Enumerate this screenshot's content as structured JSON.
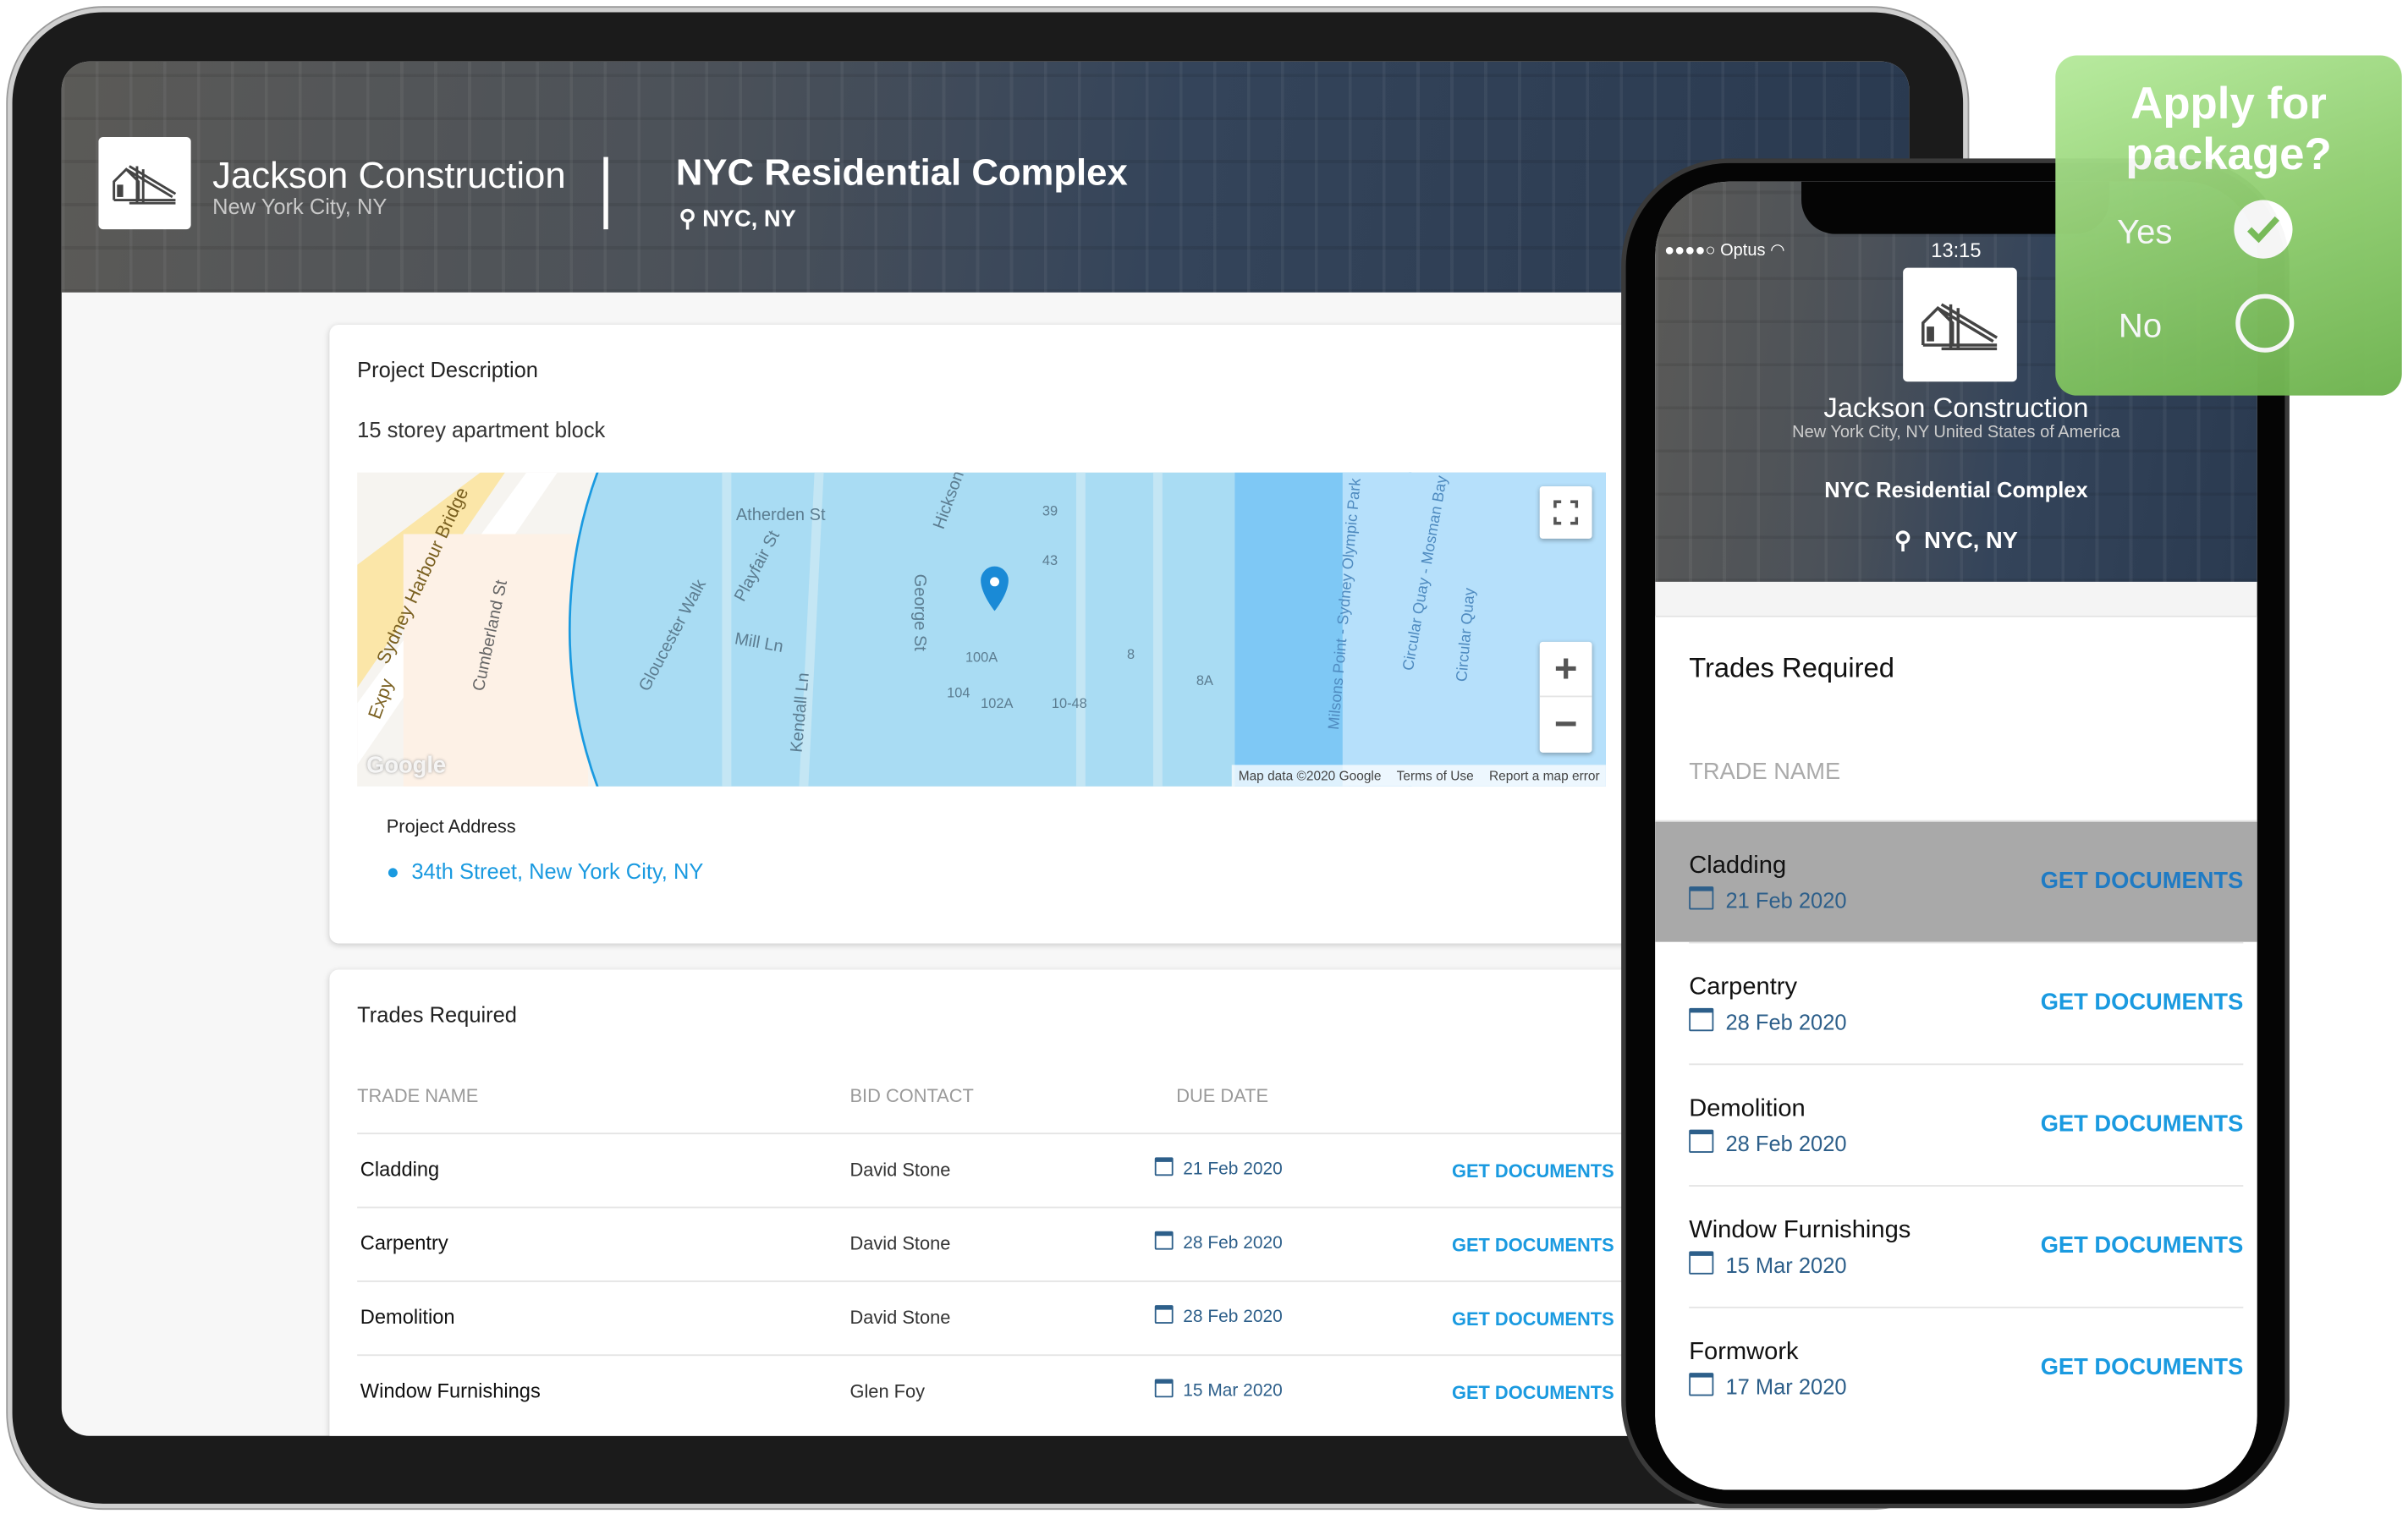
{
  "tablet": {
    "company": {
      "name": "Jackson Construction",
      "location": "New York City, NY"
    },
    "project": {
      "title": "NYC Residential Complex",
      "location": "NYC, NY"
    },
    "description": {
      "heading": "Project Description",
      "text": "15 storey apartment block"
    },
    "map": {
      "labels": [
        "Atherden St",
        "Gloucester Walk",
        "Playfair St",
        "George St",
        "Hickson",
        "Mill Ln",
        "Kendall Ln",
        "Cumberland St",
        "Sydney Harbour Bridge",
        "Expy",
        "Milsons Point - Sydney Olympic Park",
        "Circular Quay - Mosman Bay",
        "Circular Quay",
        "100A",
        "102A",
        "104",
        "8",
        "8A",
        "10-48",
        "39",
        "43"
      ],
      "brand": "Google",
      "attribution": "Map data ©2020 Google",
      "terms": "Terms of Use",
      "report": "Report a map error",
      "zoom_in": "+",
      "zoom_out": "−"
    },
    "address": {
      "label": "Project Address",
      "value": "34th Street, New York City, NY"
    },
    "trades": {
      "heading": "Trades Required",
      "columns": [
        "TRADE NAME",
        "BID CONTACT",
        "DUE DATE"
      ],
      "rows": [
        {
          "name": "Cladding",
          "contact": "David Stone",
          "date": "21 Feb 2020",
          "action": "GET DOCUMENTS"
        },
        {
          "name": "Carpentry",
          "contact": "David Stone",
          "date": "28 Feb 2020",
          "action": "GET DOCUMENTS"
        },
        {
          "name": "Demolition",
          "contact": "David Stone",
          "date": "28 Feb 2020",
          "action": "GET DOCUMENTS"
        },
        {
          "name": "Window Furnishings",
          "contact": "Glen Foy",
          "date": "15 Mar 2020",
          "action": "GET DOCUMENTS"
        }
      ]
    }
  },
  "phone": {
    "status": {
      "carrier": "●●●●○ Optus",
      "time": "13:15"
    },
    "company": {
      "name": "Jackson Construction",
      "location": "New York City, NY United States of America"
    },
    "project": {
      "title": "NYC Residential Complex",
      "location": "NYC, NY"
    },
    "trades": {
      "heading": "Trades Required",
      "column": "TRADE NAME",
      "rows": [
        {
          "name": "Cladding",
          "date": "21 Feb 2020",
          "action": "GET DOCUMENTS",
          "selected": true
        },
        {
          "name": "Carpentry",
          "date": "28 Feb 2020",
          "action": "GET DOCUMENTS"
        },
        {
          "name": "Demolition",
          "date": "28 Feb 2020",
          "action": "GET DOCUMENTS"
        },
        {
          "name": "Window Furnishings",
          "date": "15 Mar 2020",
          "action": "GET DOCUMENTS"
        },
        {
          "name": "Formwork",
          "date": "17 Mar 2020",
          "action": "GET DOCUMENTS"
        }
      ]
    }
  },
  "popup": {
    "title": "Apply for package?",
    "yes": "Yes",
    "no": "No",
    "selected": "Yes"
  },
  "colors": {
    "accent": "#1a9ae0",
    "date": "#2d5f8a",
    "popup_green": "#8fcd6f",
    "selected_row": "#a9a9a9"
  }
}
